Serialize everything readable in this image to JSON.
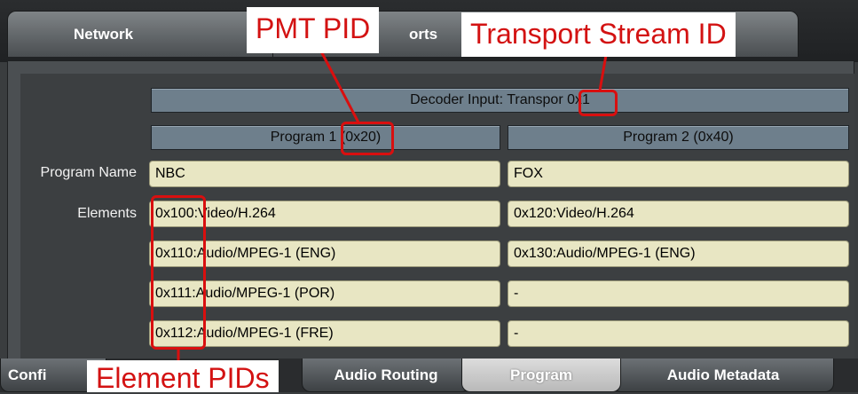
{
  "top_tabs": [
    {
      "label": "Network"
    },
    {
      "label": "orts"
    }
  ],
  "decoder_header": "Decoder Input: Transpor 0x1",
  "programs": [
    {
      "header": "Program 1 (0x20)",
      "name": "NBC",
      "elements": [
        "0x100:Video/H.264",
        "0x110:Audio/MPEG-1 (ENG)",
        "0x111:Audio/MPEG-1 (POR)",
        "0x112:Audio/MPEG-1 (FRE)"
      ]
    },
    {
      "header": "Program 2 (0x40)",
      "name": "FOX",
      "elements": [
        "0x120:Video/H.264",
        "0x130:Audio/MPEG-1 (ENG)",
        "-",
        "-"
      ]
    }
  ],
  "row_labels": {
    "program_name": "Program Name",
    "elements": "Elements"
  },
  "bottom_tabs": [
    {
      "label": "Confi"
    },
    {
      "label": "Audio Routing"
    },
    {
      "label": "Program"
    },
    {
      "label": "Audio Metadata"
    }
  ],
  "annotations": {
    "pmt_pid": "PMT PID",
    "transport_stream_id": "Transport Stream ID",
    "element_pids": "Element PIDs"
  },
  "colors": {
    "annotation_red": "#d31212",
    "field_bg": "#e8e6c3",
    "header_bg": "#6e7f8c"
  }
}
